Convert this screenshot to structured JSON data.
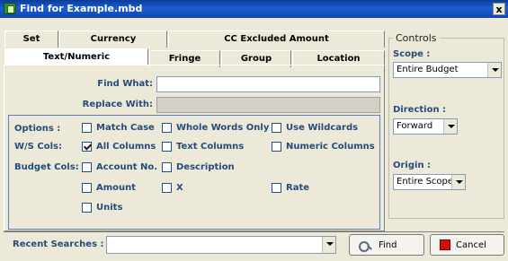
{
  "window": {
    "title": "Find for Example.mbd",
    "close_glyph": "x"
  },
  "tabs_row1": [
    {
      "label": "Set"
    },
    {
      "label": "Currency"
    },
    {
      "label": "CC Excluded Amount"
    }
  ],
  "tabs_row2": [
    {
      "label": "Text/Numeric",
      "active": true
    },
    {
      "label": "Fringe"
    },
    {
      "label": "Group"
    },
    {
      "label": "Location"
    }
  ],
  "find": {
    "find_what_label": "Find What:",
    "find_what_value": "",
    "replace_with_label": "Replace With:",
    "replace_with_value": ""
  },
  "options": {
    "options_label": "Options :",
    "ws_cols_label": "W/S Cols:",
    "budget_cols_label": "Budget Cols:",
    "match_case": {
      "label": "Match Case",
      "checked": false
    },
    "whole_words_only": {
      "label": "Whole Words Only",
      "checked": false
    },
    "use_wildcards": {
      "label": "Use Wildcards",
      "checked": false
    },
    "all_columns": {
      "label": "All Columns",
      "checked": true
    },
    "text_columns": {
      "label": "Text Columns",
      "checked": false
    },
    "numeric_columns": {
      "label": "Numeric Columns",
      "checked": false
    },
    "account_no": {
      "label": "Account No.",
      "checked": false
    },
    "description": {
      "label": "Description",
      "checked": false
    },
    "amount": {
      "label": "Amount",
      "checked": false
    },
    "x": {
      "label": "X",
      "checked": false
    },
    "rate": {
      "label": "Rate",
      "checked": false
    },
    "units": {
      "label": "Units",
      "checked": false
    }
  },
  "controls": {
    "legend": "Controls",
    "scope_label": "Scope :",
    "scope_value": "Entire Budget",
    "direction_label": "Direction :",
    "direction_value": "Forward",
    "origin_label": "Origin :",
    "origin_value": "Entire Scope"
  },
  "bottom": {
    "recent_searches_label": "Recent Searches :",
    "recent_searches_value": "",
    "find_button": "Find",
    "cancel_button": "Cancel"
  },
  "colors": {
    "title_bar": "#1c5dcf",
    "label_text": "#244b7c",
    "cancel_icon": "#d10f0f"
  }
}
